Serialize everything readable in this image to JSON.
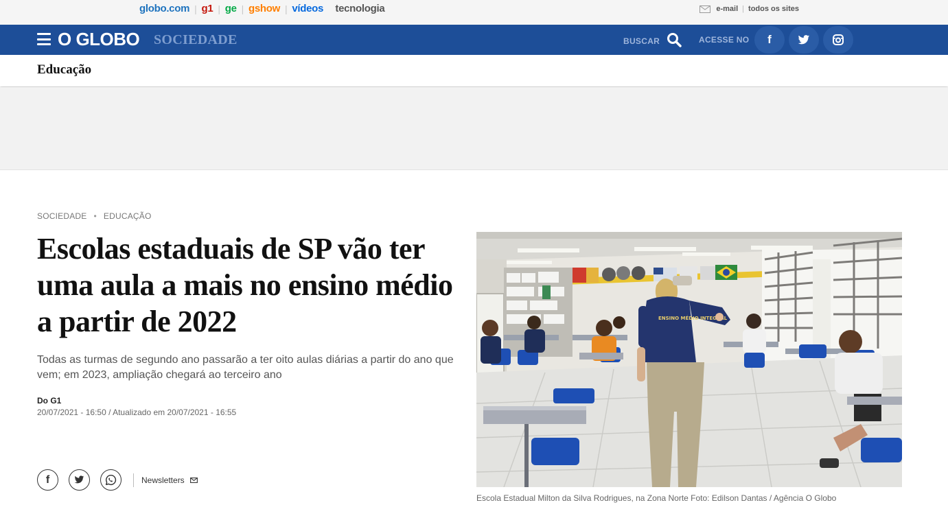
{
  "globalbar": {
    "links": [
      {
        "label": "globo.com",
        "color": "#1e73be"
      },
      {
        "label": "g1",
        "color": "#c4170c"
      },
      {
        "label": "ge",
        "color": "#06aa48"
      },
      {
        "label": "gshow",
        "color": "#ff7f00"
      },
      {
        "label": "vídeos",
        "color": "#0669de"
      },
      {
        "label": "tecnologia",
        "color": "#555555"
      }
    ],
    "email_label": "e-mail",
    "all_sites_label": "todos os sites"
  },
  "header": {
    "logo": "O GLOBO",
    "section": "SOCIEDADE",
    "search_label": "BUSCAR",
    "access_label": "ACESSE NO",
    "brand_color": "#1d4e98"
  },
  "section_bar": {
    "title": "Educação"
  },
  "article": {
    "breadcrumb": [
      "SOCIEDADE",
      "EDUCAÇÃO"
    ],
    "headline": "Escolas estaduais de SP vão ter uma aula a mais no ensino médio a partir de 2022",
    "subtitle": "Todas as turmas de segundo ano passarão a ter oito aulas diárias a partir do ano que vem; em 2023, ampliação chegará ao terceiro ano",
    "author": "Do G1",
    "dates": "20/07/2021 - 16:50 / Atualizado em 20/07/2021 - 16:55",
    "newsletters_label": "Newsletters",
    "photo_caption": "Escola Estadual Milton da Silva Rodrigues, na Zona Norte Foto: Edilson Dantas / Agência O Globo",
    "teacher_shirt_text": "ENSINO MÉDIO INTEGRAL"
  }
}
